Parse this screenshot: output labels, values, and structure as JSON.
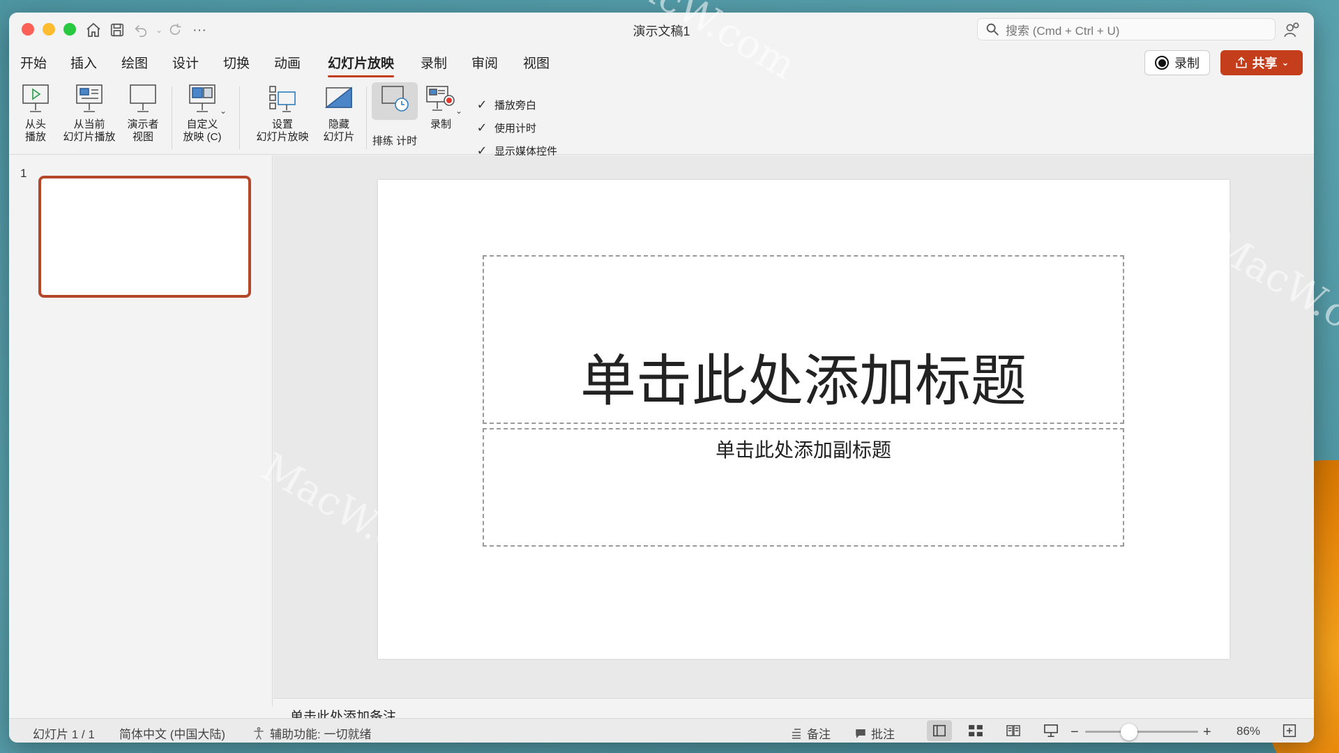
{
  "window": {
    "title": "演示文稿1",
    "search_placeholder": "搜索 (Cmd + Ctrl + U)"
  },
  "tabs": [
    "开始",
    "插入",
    "绘图",
    "设计",
    "切换",
    "动画",
    "幻灯片放映",
    "录制",
    "审阅",
    "视图"
  ],
  "active_tab": "幻灯片放映",
  "header_buttons": {
    "record": "录制",
    "share": "共享"
  },
  "ribbon": {
    "from_start": "从头\n播放",
    "from_current": "从当前\n幻灯片播放",
    "presenter_view": "演示者\n视图",
    "custom_show": "自定义\n放映 (C)",
    "setup_show": "设置\n幻灯片放映",
    "hide_slide": "隐藏\n幻灯片",
    "rehearse": "排练\n计时",
    "record": "录制",
    "checkboxes": [
      {
        "label": "播放旁白",
        "checked": true
      },
      {
        "label": "使用计时",
        "checked": true
      },
      {
        "label": "显示媒体控件",
        "checked": true
      }
    ]
  },
  "thumbnails": {
    "slide_number": "1"
  },
  "slide": {
    "title_placeholder": "单击此处添加标题",
    "subtitle_placeholder": "单击此处添加副标题"
  },
  "notes_placeholder": "单击此处添加备注",
  "status": {
    "slide_count": "幻灯片 1 / 1",
    "language": "简体中文 (中国大陆)",
    "accessibility": "辅助功能: 一切就绪",
    "notes": "备注",
    "comments": "批注",
    "zoom": "86%"
  },
  "watermark": "MacW.com",
  "colors": {
    "accent": "#c43e1c",
    "thumb_border": "#b5462a"
  }
}
